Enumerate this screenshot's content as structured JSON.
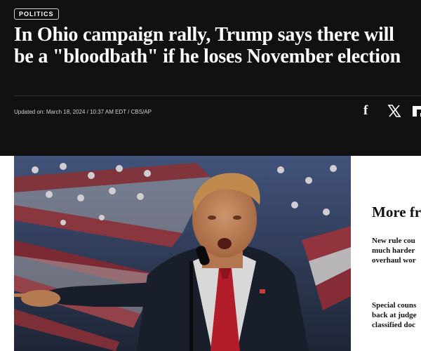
{
  "article": {
    "category": "POLITICS",
    "headline": "In Ohio campaign rally, Trump says there will be a \"bloodbath\" if he loses November election",
    "meta": "Updated on: March 18, 2024 / 10:37 AM EDT / CBS/AP"
  },
  "share": {
    "icons": [
      "facebook-icon",
      "x-icon",
      "flipboard-icon"
    ],
    "facebook_glyph": "f"
  },
  "sidebar": {
    "heading": "More fr",
    "stories": [
      {
        "lines": [
          "New rule cou",
          "much harder",
          "overhaul wor"
        ]
      },
      {
        "lines": [
          "Special couns",
          "back at judge",
          "classified doc"
        ]
      }
    ]
  },
  "colors": {
    "header_bg": "#111111",
    "text_light": "#ffffff",
    "meta_text": "#cfcfcf"
  }
}
